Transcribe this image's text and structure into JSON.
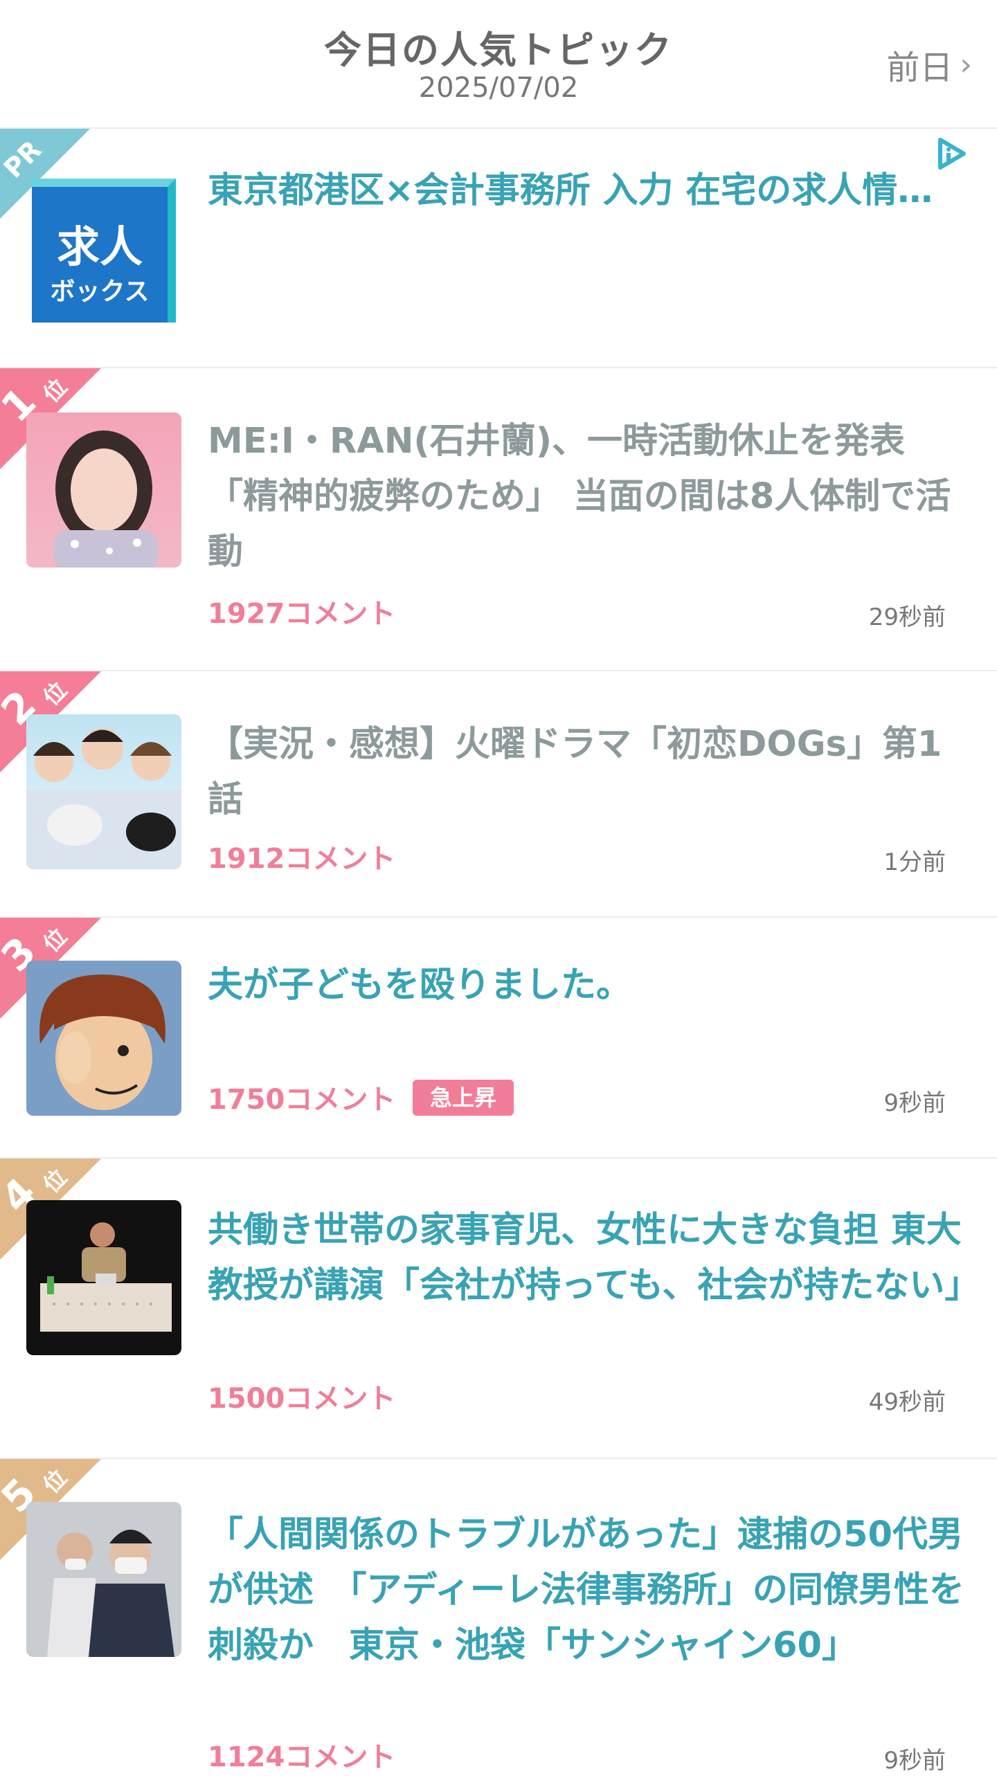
{
  "header": {
    "title": "今日の人気トピック",
    "date": "2025/07/02",
    "prev_label": "前日"
  },
  "colors": {
    "unread_text": "#37a3b5",
    "read_text": "#8c9a9b",
    "comment_pink": "#f27d98",
    "pr_ribbon": "#7fc9d6",
    "rank_1_2_3": "#f47e97",
    "rank_4_5": "#e2b98a"
  },
  "ad": {
    "ribbon": "PR",
    "logo_text_1": "求人",
    "logo_text_2": "ボックス",
    "title": "東京都港区×会計事務所 入力 在宅の求人情…",
    "adchoices_icon": "adchoices-icon"
  },
  "topics": [
    {
      "rank": "1",
      "rank_suffix": "位",
      "title": "ME:I・RAN(石井蘭)、一時活動休止を発表「精神的疲弊のため」 当面の間は8人体制で活動",
      "comments": "1927コメント",
      "time": "29秒前",
      "read": true,
      "badge": ""
    },
    {
      "rank": "2",
      "rank_suffix": "位",
      "title": "【実況・感想】火曜ドラマ「初恋DOGs」第1話",
      "comments": "1912コメント",
      "time": "1分前",
      "read": true,
      "badge": ""
    },
    {
      "rank": "3",
      "rank_suffix": "位",
      "title": "夫が子どもを殴りました。",
      "comments": "1750コメント",
      "time": "9秒前",
      "read": false,
      "badge": "急上昇"
    },
    {
      "rank": "4",
      "rank_suffix": "位",
      "title": "共働き世帯の家事育児、女性に大きな負担 東大教授が講演「会社が持っても、社会が持たない」",
      "comments": "1500コメント",
      "time": "49秒前",
      "read": false,
      "badge": ""
    },
    {
      "rank": "5",
      "rank_suffix": "位",
      "title": "「人間関係のトラブルがあった」逮捕の50代男が供述　「アディーレ法律事務所」の同僚男性を刺殺か　東京・池袋「サンシャイン60」",
      "comments": "1124コメント",
      "time": "9秒前",
      "read": false,
      "badge": ""
    }
  ]
}
